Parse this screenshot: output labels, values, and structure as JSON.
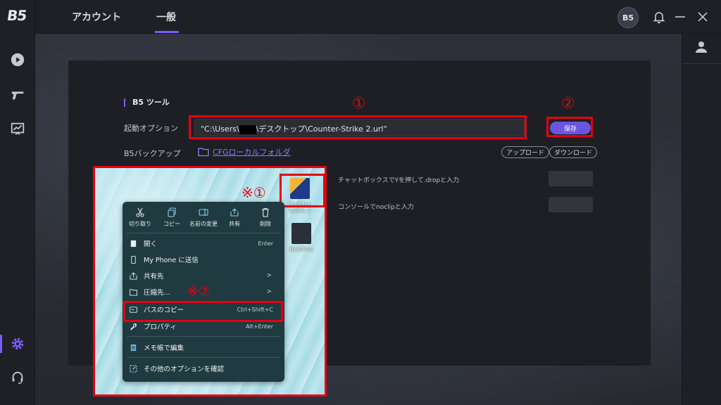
{
  "topbar": {
    "tabs": [
      {
        "label": "アカウント"
      },
      {
        "label": "一般"
      }
    ],
    "avatar_text": "B5"
  },
  "sidebar": {
    "logo": "B5",
    "icons": [
      "play-icon",
      "gun-icon",
      "chart-icon",
      "gear-icon",
      "headset-icon"
    ],
    "active": "gear-icon"
  },
  "panel": {
    "section_title": "B5 ツール",
    "launch_label": "起動オプション",
    "path_prefix": "\"C:\\Users\\",
    "path_suffix": "\\デスクトップ\\Counter-Strike 2.url\"",
    "save_label": "保存",
    "backup_label": "B5バックアップ",
    "cfg_link": "CFGローカルフォルダ",
    "upload_label": "アップロード",
    "download_label": "ダウンロード",
    "cmd1": "チャットボックスでYを押して.dropと入力",
    "cmd2": "コンソールでnoclipと入力"
  },
  "annotations": {
    "num1": "①",
    "num2": "②",
    "note1": "※①",
    "note2": "※②",
    "color": "#e60012"
  },
  "overlay": {
    "desktop_icons": [
      {
        "label": "Counter-Strike 2"
      },
      {
        "label": "BestFive"
      }
    ],
    "quick_actions": [
      {
        "label": "切り取り",
        "icon": "scissors-icon"
      },
      {
        "label": "コピー",
        "icon": "copy-icon"
      },
      {
        "label": "名前の変更",
        "icon": "rename-icon"
      },
      {
        "label": "共有",
        "icon": "share-icon"
      },
      {
        "label": "削除",
        "icon": "trash-icon"
      }
    ],
    "menu": [
      {
        "label": "開く",
        "shortcut": "Enter"
      },
      {
        "label": "My Phone に送信",
        "shortcut": ""
      },
      {
        "label": "共有先",
        "shortcut": ">"
      },
      {
        "label": "圧縮先...",
        "shortcut": ">"
      },
      {
        "label": "パスのコピー",
        "shortcut": "Ctrl+Shift+C"
      },
      {
        "label": "プロパティ",
        "shortcut": "Alt+Enter"
      },
      {
        "label": "メモ帳で編集",
        "shortcut": ""
      },
      {
        "label": "その他のオプションを確認",
        "shortcut": ""
      }
    ]
  },
  "colors": {
    "accent": "#7c5cff",
    "save_button": "#6b55e0",
    "panel_bg": "#1e1f24"
  }
}
